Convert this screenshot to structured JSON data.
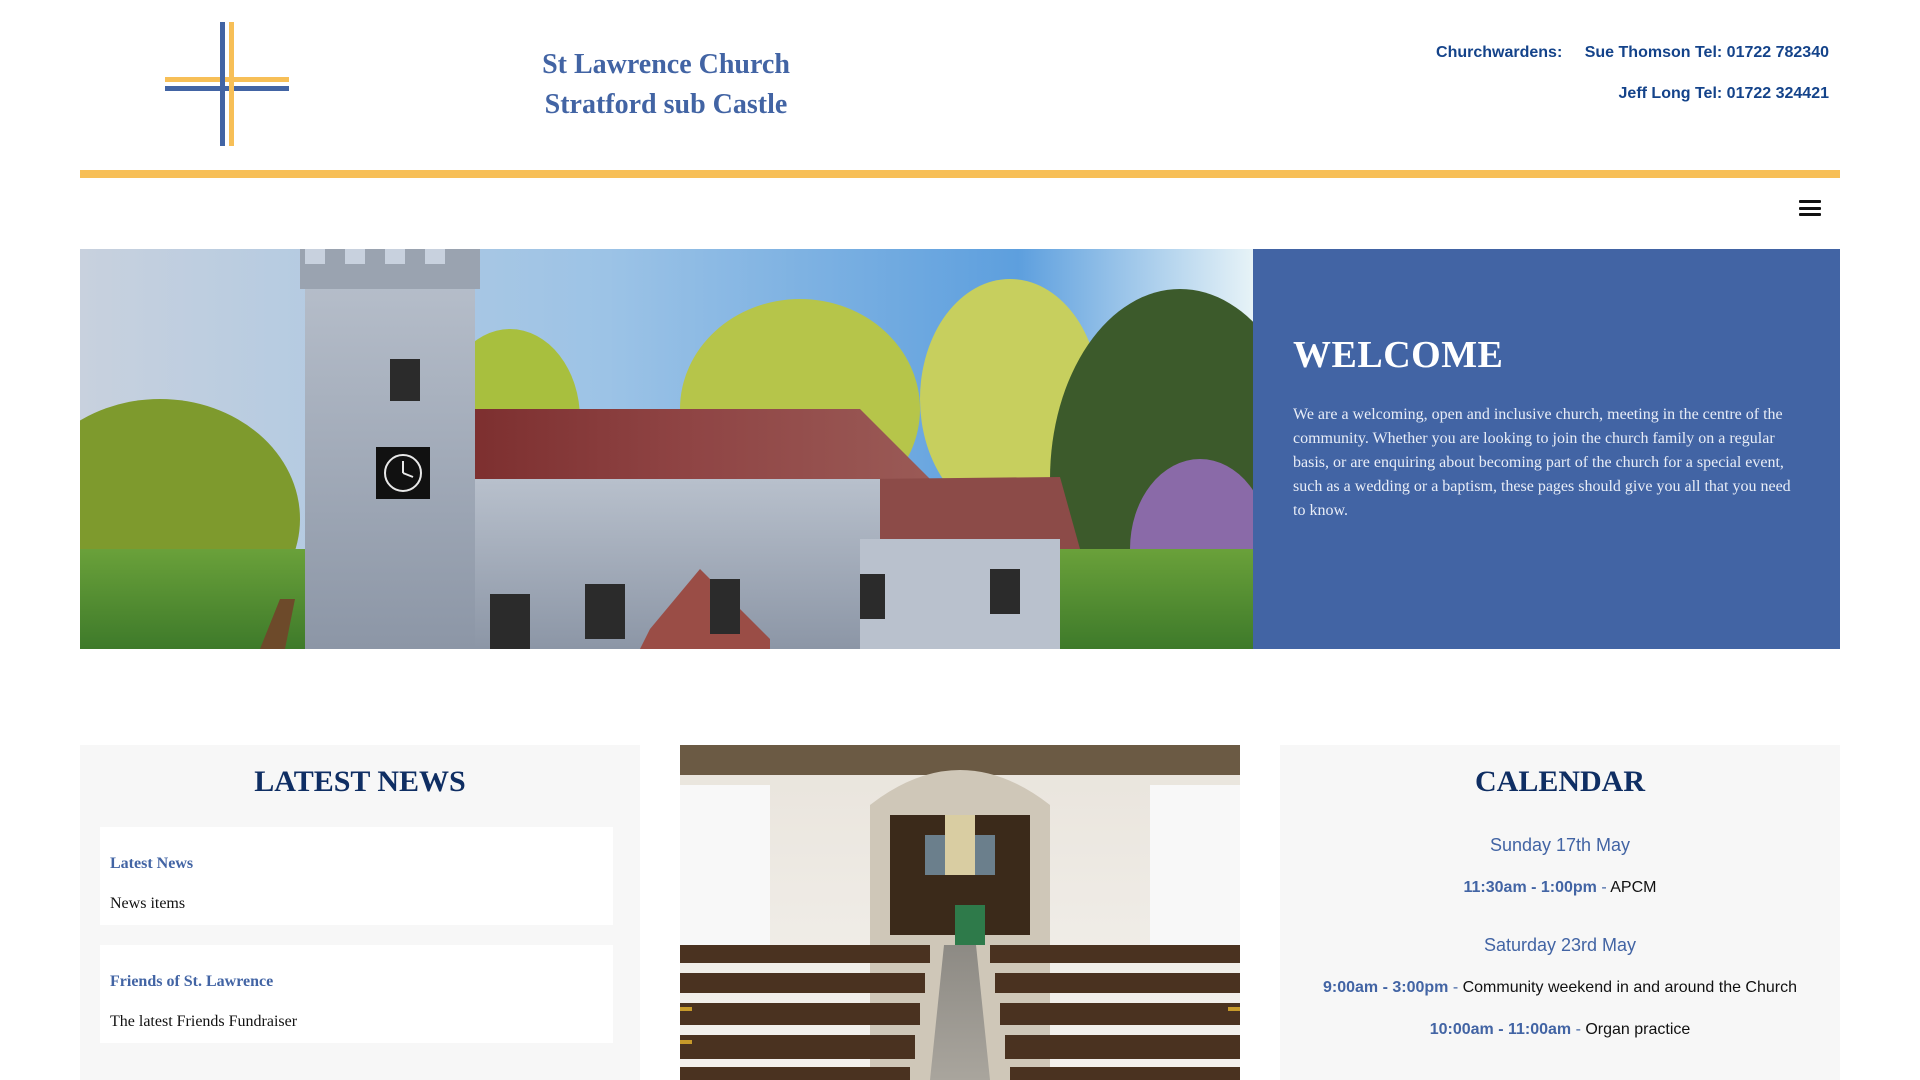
{
  "header": {
    "title_line1": "St Lawrence Church",
    "title_line2": "Stratford sub Castle",
    "contacts": {
      "label": "Churchwardens:",
      "contact1": "Sue Thomson Tel: 01722 782340",
      "contact2": "Jeff Long Tel: 01722 324421"
    },
    "menu_icon": "hamburger-menu-icon"
  },
  "welcome": {
    "heading": "WELCOME",
    "body": "We are a welcoming, open and inclusive church, meeting in the centre of the community. Whether you are looking to join the church family on a regular basis, or are enquiring about becoming part of the church for a special event, such as a wedding or a baptism, these pages should give you all that you need to know."
  },
  "news": {
    "heading": "LATEST NEWS",
    "items": [
      {
        "title": "Latest News",
        "subtitle": "News items"
      },
      {
        "title": "Friends of St. Lawrence",
        "subtitle": "The latest Friends Fundraiser"
      }
    ]
  },
  "calendar": {
    "heading": "CALENDAR",
    "days": [
      {
        "date": "Sunday 17th May",
        "events": [
          {
            "time": "11:30am - 1:00pm",
            "title": "APCM"
          }
        ]
      },
      {
        "date": "Saturday 23rd May",
        "events": [
          {
            "time": "9:00am - 3:00pm",
            "title": "Community weekend in and around the Church"
          },
          {
            "time": "10:00am - 11:00am",
            "title": "Organ practice"
          }
        ]
      }
    ],
    "separator": " - "
  },
  "colors": {
    "brand_blue": "#4264a4",
    "dark_blue": "#0f2e63",
    "gold": "#f7bf57",
    "card_bg": "#f7f7f7"
  }
}
